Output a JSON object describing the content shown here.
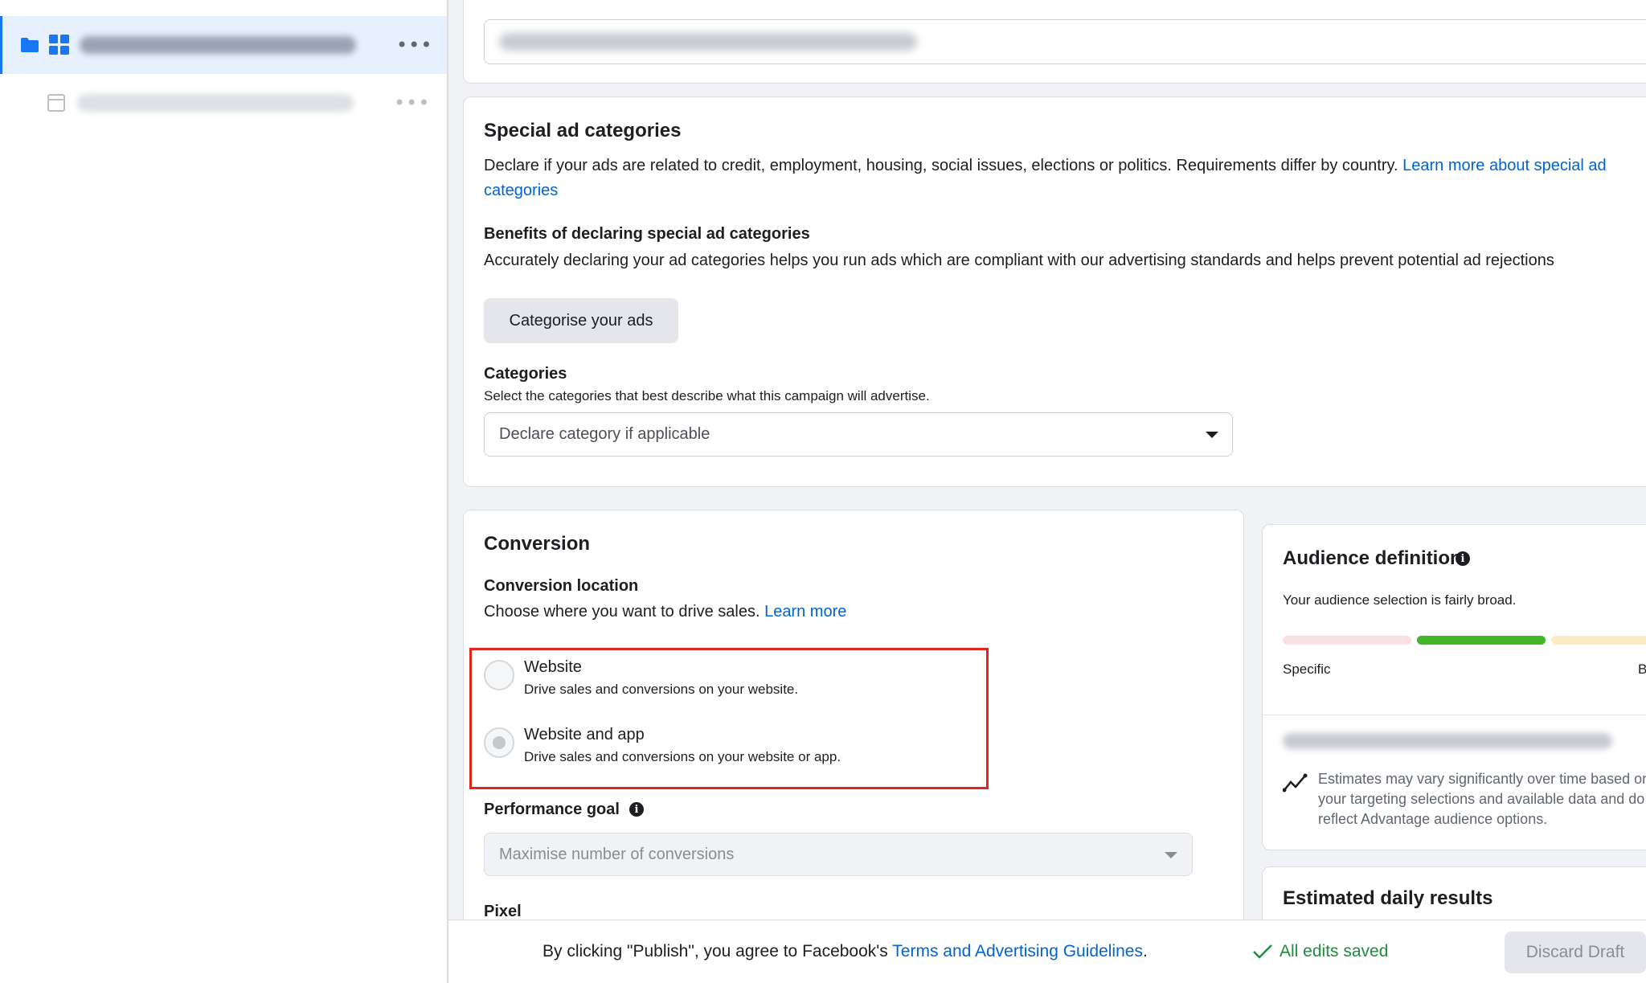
{
  "sidebar": {
    "items": [
      {
        "type": "campaign",
        "icons": [
          "folder-icon",
          "grid-icon"
        ],
        "name_blurred": true,
        "more": "•••"
      },
      {
        "type": "ad",
        "icons": [
          "page-icon"
        ],
        "name_blurred": true,
        "more": "•••"
      }
    ]
  },
  "special_ad_categories": {
    "title": "Special ad categories",
    "description": "Declare if your ads are related to credit, employment, housing, social issues, elections or politics. Requirements differ by country.",
    "learn_more_link": "Learn more about special ad categories",
    "benefits_title": "Benefits of declaring special ad categories",
    "benefits_text": "Accurately declaring your ad categories helps you run ads which are compliant with our advertising standards and helps prevent potential ad rejections",
    "categorise_button": "Categorise your ads",
    "categories_label": "Categories",
    "categories_help": "Select the categories that best describe what this campaign will advertise.",
    "categories_select": "Declare category if applicable"
  },
  "conversion": {
    "title": "Conversion",
    "location_label": "Conversion location",
    "location_help": "Choose where you want to drive sales.",
    "learn_more": "Learn more",
    "options": [
      {
        "title": "Website",
        "desc": "Drive sales and conversions on your website.",
        "selected": false
      },
      {
        "title": "Website and app",
        "desc": "Drive sales and conversions on your website or app.",
        "selected": true
      }
    ],
    "performance_goal_label": "Performance goal",
    "performance_goal_value": "Maximise number of conversions",
    "pixel_label": "Pixel"
  },
  "audience": {
    "title": "Audience definition",
    "status": "Your audience selection is fairly broad.",
    "meter_labels": {
      "left": "Specific",
      "right": "B"
    },
    "meter_colors": [
      "#fbe0e0",
      "#42b72a",
      "#fcebc4"
    ],
    "estimates_note": "Estimates may vary significantly over time based on your targeting selections and available data and do not reflect Advantage audience options."
  },
  "estimated_daily": {
    "title": "Estimated daily results"
  },
  "footer": {
    "agree_prefix": "By clicking \"Publish\", you agree to Facebook's",
    "terms_link": "Terms and Advertising Guidelines",
    "agree_suffix": ".",
    "saved_status": "All edits saved",
    "discard_button": "Discard Draft"
  }
}
